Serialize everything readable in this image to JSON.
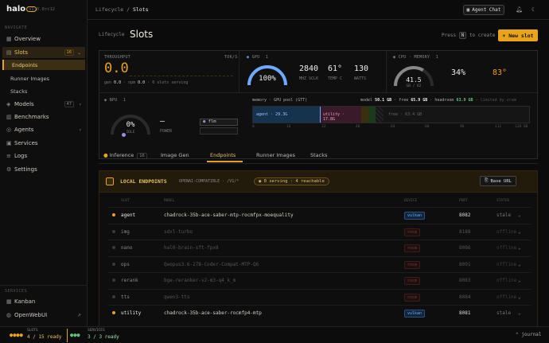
{
  "sidebar": {
    "logo": "halo",
    "version": "v1.0.0rc12",
    "navigate_label": "NAVIGATE",
    "items": [
      {
        "label": "Overview",
        "icon": "grid-icon"
      },
      {
        "label": "Slots",
        "icon": "slots-icon",
        "badge": "16"
      },
      {
        "label": "Endpoints"
      },
      {
        "label": "Runner Images"
      },
      {
        "label": "Stacks"
      },
      {
        "label": "Models",
        "icon": "cube-icon",
        "badge": "47"
      },
      {
        "label": "Benchmarks",
        "icon": "chart-icon"
      },
      {
        "label": "Agents",
        "icon": "agent-icon"
      },
      {
        "label": "Services",
        "icon": "server-icon"
      },
      {
        "label": "Logs",
        "icon": "list-icon"
      },
      {
        "label": "Settings",
        "icon": "gear-icon"
      }
    ],
    "services_label": "SERVICES",
    "services": [
      {
        "label": "Kanban"
      },
      {
        "label": "OpenWebUI"
      }
    ]
  },
  "topbar": {
    "breadcrumb_parent": "Lifecycle",
    "breadcrumb_sep": "/",
    "breadcrumb_current": "Slots",
    "agent_chat": "Agent Chat"
  },
  "page": {
    "label": "Lifecycle",
    "title": "Slots",
    "hint_pre": "Press",
    "hint_key": "N",
    "hint_post": "to create",
    "new_button": "+ New slot"
  },
  "stats": {
    "throughput_label": "THROUGHPUT",
    "throughput_unit": "TOK/S",
    "throughput_value": "0.0",
    "gen_label": "gen",
    "gen_value": "0.0",
    "npm_label": "npm",
    "npm_value": "0.0",
    "serving": "0 slots serving",
    "gpu_label": "GPU",
    "gpu_count": "1",
    "gpu_pct": "100%",
    "gpu_pct_value": 100,
    "gpu_mhz": "2840",
    "gpu_mhz_label": "MHZ SCLK",
    "gpu_temp": "61°",
    "gpu_temp_label": "TEMP C",
    "gpu_power": "130",
    "gpu_power_label": "WATTS",
    "cpu_label": "CPU · MEMORY",
    "cpu_count": "1",
    "cpu_ghz": "41.5",
    "cpu_ghz_label": "GB / 62",
    "cpu_ghz_value": 0.67,
    "cpu_pct": "34%",
    "cpu_temp": "83°",
    "npu_label": "NPU",
    "npu_count": "1",
    "npu_pct": "0%",
    "npu_pct_value": 0,
    "npu_idle": "IDLE",
    "npu_dash": "—",
    "npu_power": "POWER",
    "flm": "flm",
    "mem_label": "memory · GPU pool (GTT)",
    "mem_model_label": "model",
    "mem_model": "50.1 GB",
    "mem_free_label": "free",
    "mem_free": "65.9 GB",
    "mem_head_label": "headroom",
    "mem_head": "63.9 GB",
    "mem_limited": "— limited by vram",
    "mem_agent": "agent · 29.3G",
    "mem_utility": "utility · 17.8G",
    "mem_free_bar": "free · 63.4 GB",
    "mem_ticks": [
      "0",
      "16",
      "32",
      "48",
      "64",
      "80",
      "96",
      "112",
      "128 GB"
    ]
  },
  "tabs": [
    {
      "label": "Inference",
      "badge": "16"
    },
    {
      "label": "Image Gen"
    },
    {
      "label": "Endpoints"
    },
    {
      "label": "Runner Images"
    },
    {
      "label": "Stacks"
    }
  ],
  "endpoints": {
    "title": "LOCAL ENDPOINTS",
    "subtitle": "OPENAI-COMPATIBLE · /V1/*",
    "pill": "0 serving · 4 reachable",
    "base_url": "Base URL",
    "headers": [
      "SLOT",
      "MODEL",
      "DEVICE",
      "PORT",
      "STATUS"
    ],
    "rows": [
      {
        "name": "agent",
        "model": "chadrock-35b-ace-saber-mtp-rocmfpx-moequality",
        "device": "vulkan",
        "port": "8082",
        "status": "stale",
        "on": true
      },
      {
        "name": "img",
        "model": "sdxl-turbo",
        "device": "rocm",
        "port": "8188",
        "status": "offline",
        "on": false
      },
      {
        "name": "nano",
        "model": "hal0-brain-sft-fpx8",
        "device": "rocm",
        "port": "8086",
        "status": "offline",
        "on": false
      },
      {
        "name": "ops",
        "model": "Qwopus3.6-27B-Coder-Compat-MTP-Q6",
        "device": "rocm",
        "port": "8091",
        "status": "offline",
        "on": false
      },
      {
        "name": "rerank",
        "model": "bge-reranker-v2-m3-q4_k_m",
        "device": "rocm",
        "port": "8083",
        "status": "offline",
        "on": false
      },
      {
        "name": "tts",
        "model": "qwen3-tts",
        "device": "rocm",
        "port": "8084",
        "status": "offline",
        "on": false
      },
      {
        "name": "utility",
        "model": "chadrock-35b-ace-saber-rocmfp4-mtp",
        "device": "vulkan",
        "port": "8081",
        "status": "stale",
        "on": true
      }
    ]
  },
  "footer": {
    "slots_label": "SLOTS",
    "slots_value": "4 / 15 ready",
    "services_label": "SERVICES",
    "services_value": "3 / 3 ready",
    "journal": "journal"
  },
  "colors": {
    "accent": "#e8a317",
    "blue": "#6fa8ff",
    "vulkan": "#6fa8ff",
    "rocm": "#c0504d"
  }
}
